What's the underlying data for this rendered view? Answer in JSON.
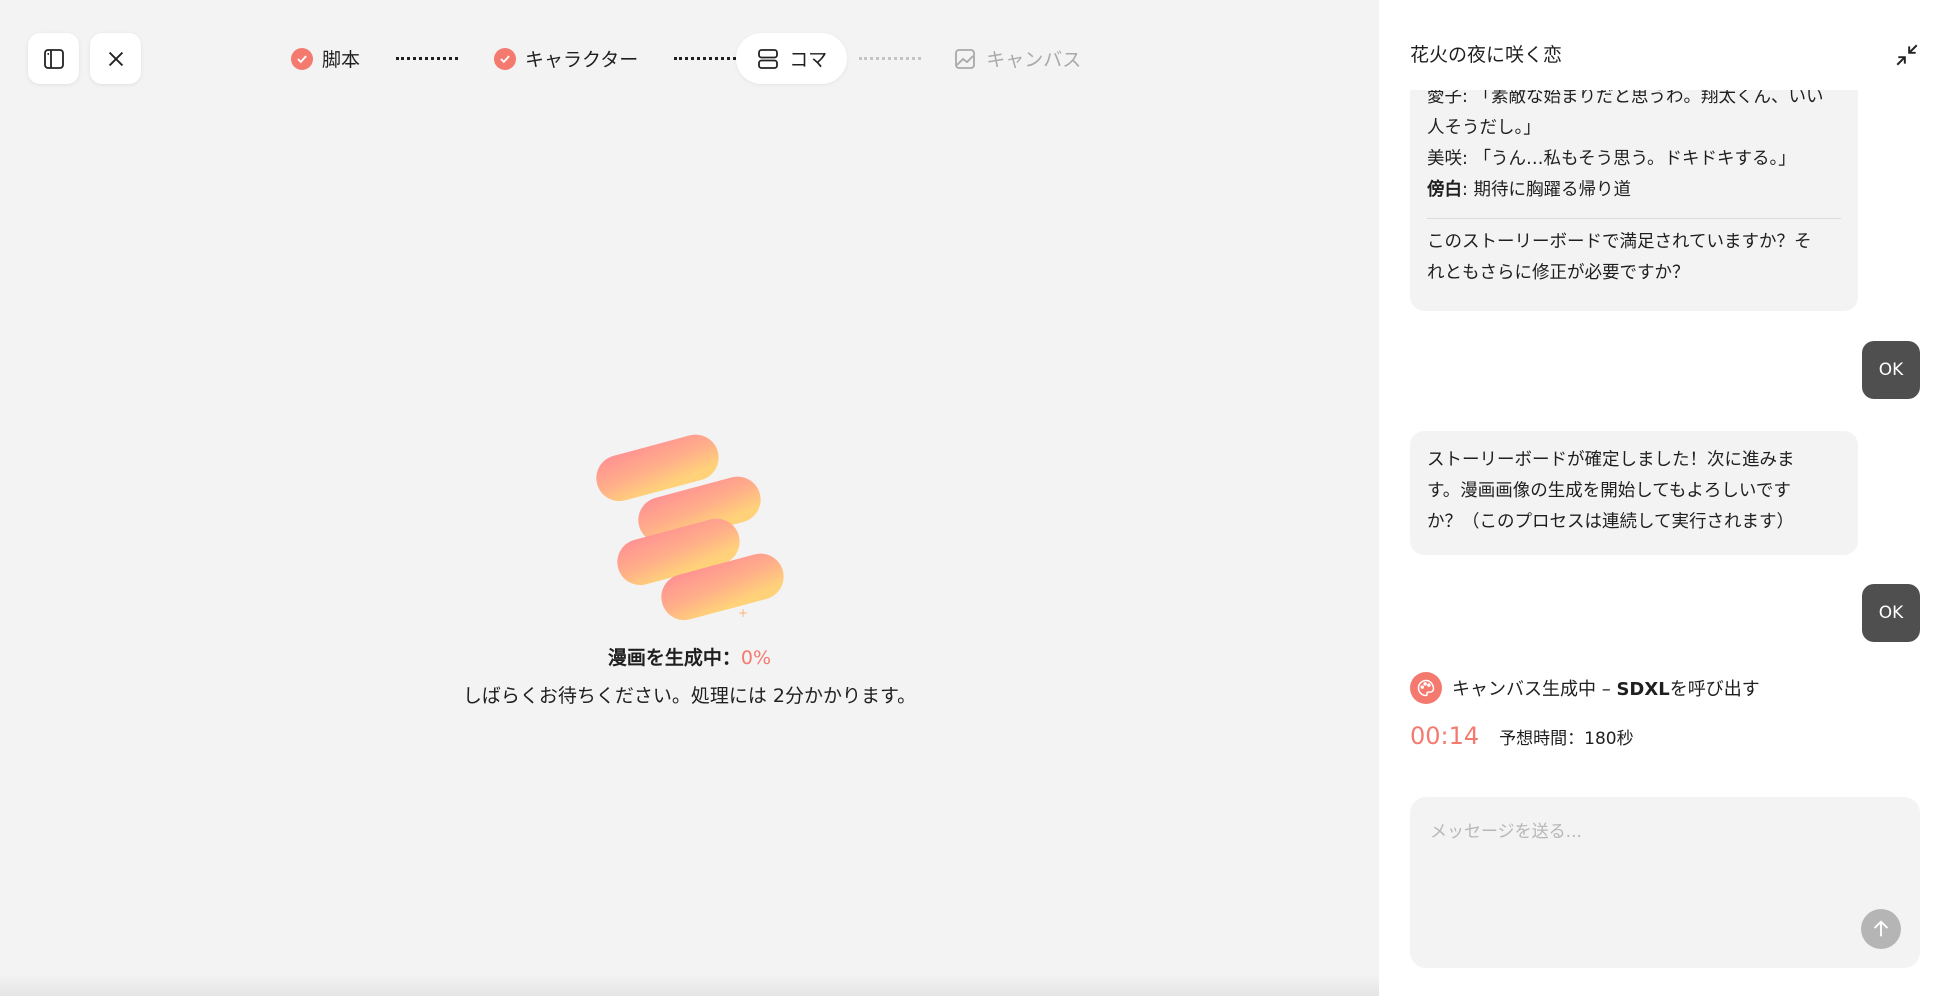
{
  "toolbar": {
    "sidebar_icon": "sidebar-toggle-icon",
    "close_icon": "close-icon"
  },
  "stepper": {
    "steps": [
      {
        "label": "脚本",
        "state": "done",
        "icon": "check-circle-icon"
      },
      {
        "label": "キャラクター",
        "state": "done",
        "icon": "check-circle-icon"
      },
      {
        "label": "コマ",
        "state": "active",
        "icon": "panels-icon"
      },
      {
        "label": "キャンバス",
        "state": "disabled",
        "icon": "image-icon"
      }
    ]
  },
  "generation": {
    "title": "漫画を生成中：",
    "percent": "0%",
    "subtitle": "しばらくお待ちください。処理には 2分かかります。"
  },
  "chat": {
    "title": "花火の夜に咲く恋",
    "collapse_icon": "collapse-icon",
    "messages": {
      "assistant_1": {
        "lines": [
          "愛子: 「素敵な始まりだと思うわ。翔太くん、いい",
          "人そうだし。」",
          "美咲: 「うん…私もそう思う。ドキドキする。」"
        ],
        "narration_label": "傍白",
        "narration_text": ": 期待に胸躍る帰り道",
        "question_lines": [
          "このストーリーボードで満足されていますか？そ",
          "れともさらに修正が必要ですか？"
        ]
      },
      "user_1": "OK",
      "assistant_2": {
        "lines": [
          "ストーリーボードが確定しました！次に進みま",
          "す。漫画画像の生成を開始してもよろしいです",
          "か？（このプロセスは連続して実行されます）"
        ]
      },
      "user_2": "OK"
    },
    "status": {
      "icon": "palette-icon",
      "text": "キャンバス生成中 – ",
      "model": "SDXL",
      "suffix": "を呼び出す",
      "timer": "00:14",
      "estimate": "予想時間：180秒"
    },
    "composer": {
      "placeholder": "メッセージを送る...",
      "value": "",
      "send_icon": "arrow-up-icon"
    }
  },
  "colors": {
    "accent": "#f47a6f",
    "background": "#f3f3f3",
    "bubble": "#f3f3f4",
    "user_bubble": "#4f4f4f"
  }
}
